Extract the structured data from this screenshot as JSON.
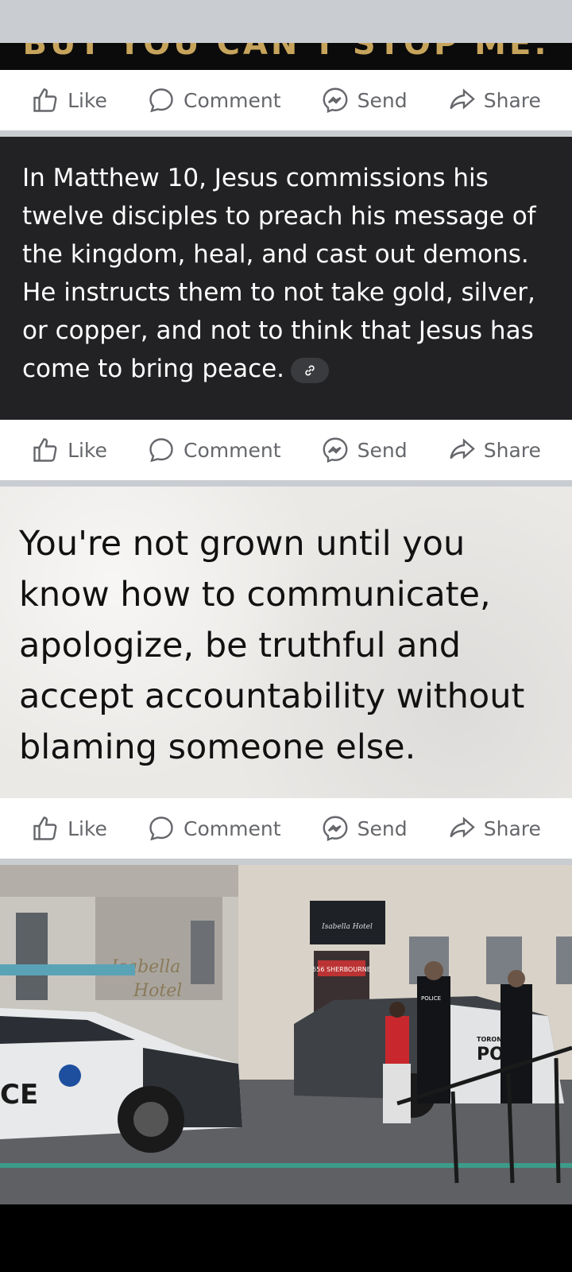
{
  "prev_post": {
    "cut_text": "BUT YOU CAN'T STOP ME."
  },
  "actions": {
    "like": "Like",
    "comment": "Comment",
    "send": "Send",
    "share": "Share"
  },
  "post1": {
    "text": "In Matthew 10, Jesus commissions his twelve disciples to preach his message of the kingdom, heal, and cast out demons. He instructs them to not take gold, silver, or copper, and not to think that Jesus has come to bring peace."
  },
  "post2": {
    "quote": "You're not grown until you know how to communicate, apologize, be truthful and accept accountability without blaming someone else."
  },
  "post3": {
    "hotel_sign_line1": "Isabella",
    "hotel_sign_line2": "Hotel",
    "awning_text": "Isabella Hotel",
    "address_sign": "556 SHERBOURNE",
    "car_left_text": "CE",
    "car_right_text": "POLICE",
    "car_right_city": "TORONTO",
    "car_right_partial": "POL",
    "officer_badge": "POLICE"
  },
  "colors": {
    "action_gray": "#65676b",
    "separator": "#c9ccd1",
    "dark_post_bg": "#222224"
  }
}
